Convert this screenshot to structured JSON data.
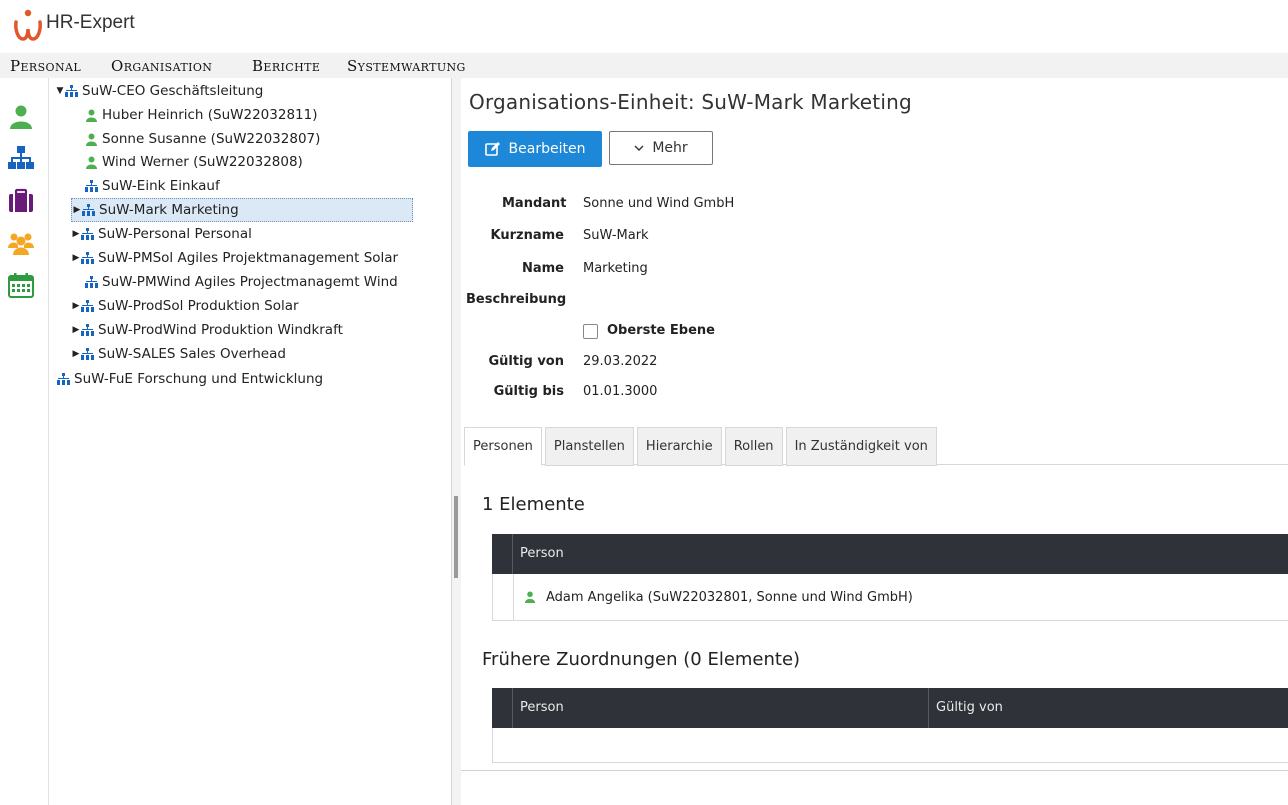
{
  "app": {
    "title": "HR-Expert",
    "colors": {
      "accent": "#1e88d8",
      "person": "#4caf50",
      "org": "#1565c0",
      "briefcase": "#6a1b7a",
      "group": "#f5a623",
      "calendar": "#2e9b3e",
      "logo": "#e0582a"
    }
  },
  "menu": {
    "items": [
      "Personal",
      "Organisation",
      "Berichte",
      "Systemwartung"
    ]
  },
  "rail": {
    "icons": [
      "person-icon",
      "org-chart-icon",
      "briefcase-icon",
      "group-icon",
      "calendar-icon"
    ]
  },
  "tree": {
    "nodes": [
      {
        "label": "SuW-CEO Geschäftsleitung",
        "icon": "org",
        "arrow": "▼"
      },
      {
        "label": "Huber Heinrich (SuW22032811)",
        "icon": "person",
        "arrow": ""
      },
      {
        "label": "Sonne Susanne (SuW22032807)",
        "icon": "person",
        "arrow": ""
      },
      {
        "label": "Wind Werner (SuW22032808)",
        "icon": "person",
        "arrow": ""
      },
      {
        "label": "SuW-Eink Einkauf",
        "icon": "org",
        "arrow": ""
      },
      {
        "label": "SuW-Mark Marketing",
        "icon": "org",
        "arrow": "▶"
      },
      {
        "label": "SuW-Personal Personal",
        "icon": "org",
        "arrow": "▶"
      },
      {
        "label": "SuW-PMSol Agiles Projektmanagement Solar",
        "icon": "org",
        "arrow": "▶"
      },
      {
        "label": "SuW-PMWind Agiles Projectmanagemt Wind",
        "icon": "org",
        "arrow": ""
      },
      {
        "label": "SuW-ProdSol Produktion Solar",
        "icon": "org",
        "arrow": "▶"
      },
      {
        "label": "SuW-ProdWind Produktion Windkraft",
        "icon": "org",
        "arrow": "▶"
      },
      {
        "label": "SuW-SALES Sales Overhead",
        "icon": "org",
        "arrow": "▶"
      },
      {
        "label": "SuW-FuE Forschung und Entwicklung",
        "icon": "org",
        "arrow": ""
      }
    ],
    "selected": "SuW-Mark Marketing"
  },
  "detail": {
    "title": "Organisations-Einheit: SuW-Mark Marketing",
    "edit_label": "Bearbeiten",
    "more_label": "Mehr",
    "fields": {
      "mandant_label": "Mandant",
      "mandant_value": "Sonne und Wind GmbH",
      "kurzname_label": "Kurzname",
      "kurzname_value": "SuW-Mark",
      "name_label": "Name",
      "name_value": "Marketing",
      "beschreibung_label": "Beschreibung",
      "oberste_label": "Oberste Ebene",
      "oberste_checked": false,
      "gueltig_von_label": "Gültig von",
      "gueltig_von_value": "29.03.2022",
      "gueltig_bis_label": "Gültig bis",
      "gueltig_bis_value": "01.01.3000"
    },
    "tabs": [
      "Personen",
      "Planstellen",
      "Hierarchie",
      "Rollen",
      "In Zuständigkeit von"
    ],
    "active_tab": "Personen",
    "elements_heading": "1 Elemente",
    "persons_table": {
      "headers": [
        "Person"
      ],
      "rows": [
        [
          "Adam Angelika (SuW22032801, Sonne und Wind GmbH)"
        ]
      ]
    },
    "former_heading": "Frühere Zuordnungen (0 Elemente)",
    "former_table": {
      "headers": [
        "Person",
        "Gültig von"
      ],
      "rows": []
    }
  }
}
